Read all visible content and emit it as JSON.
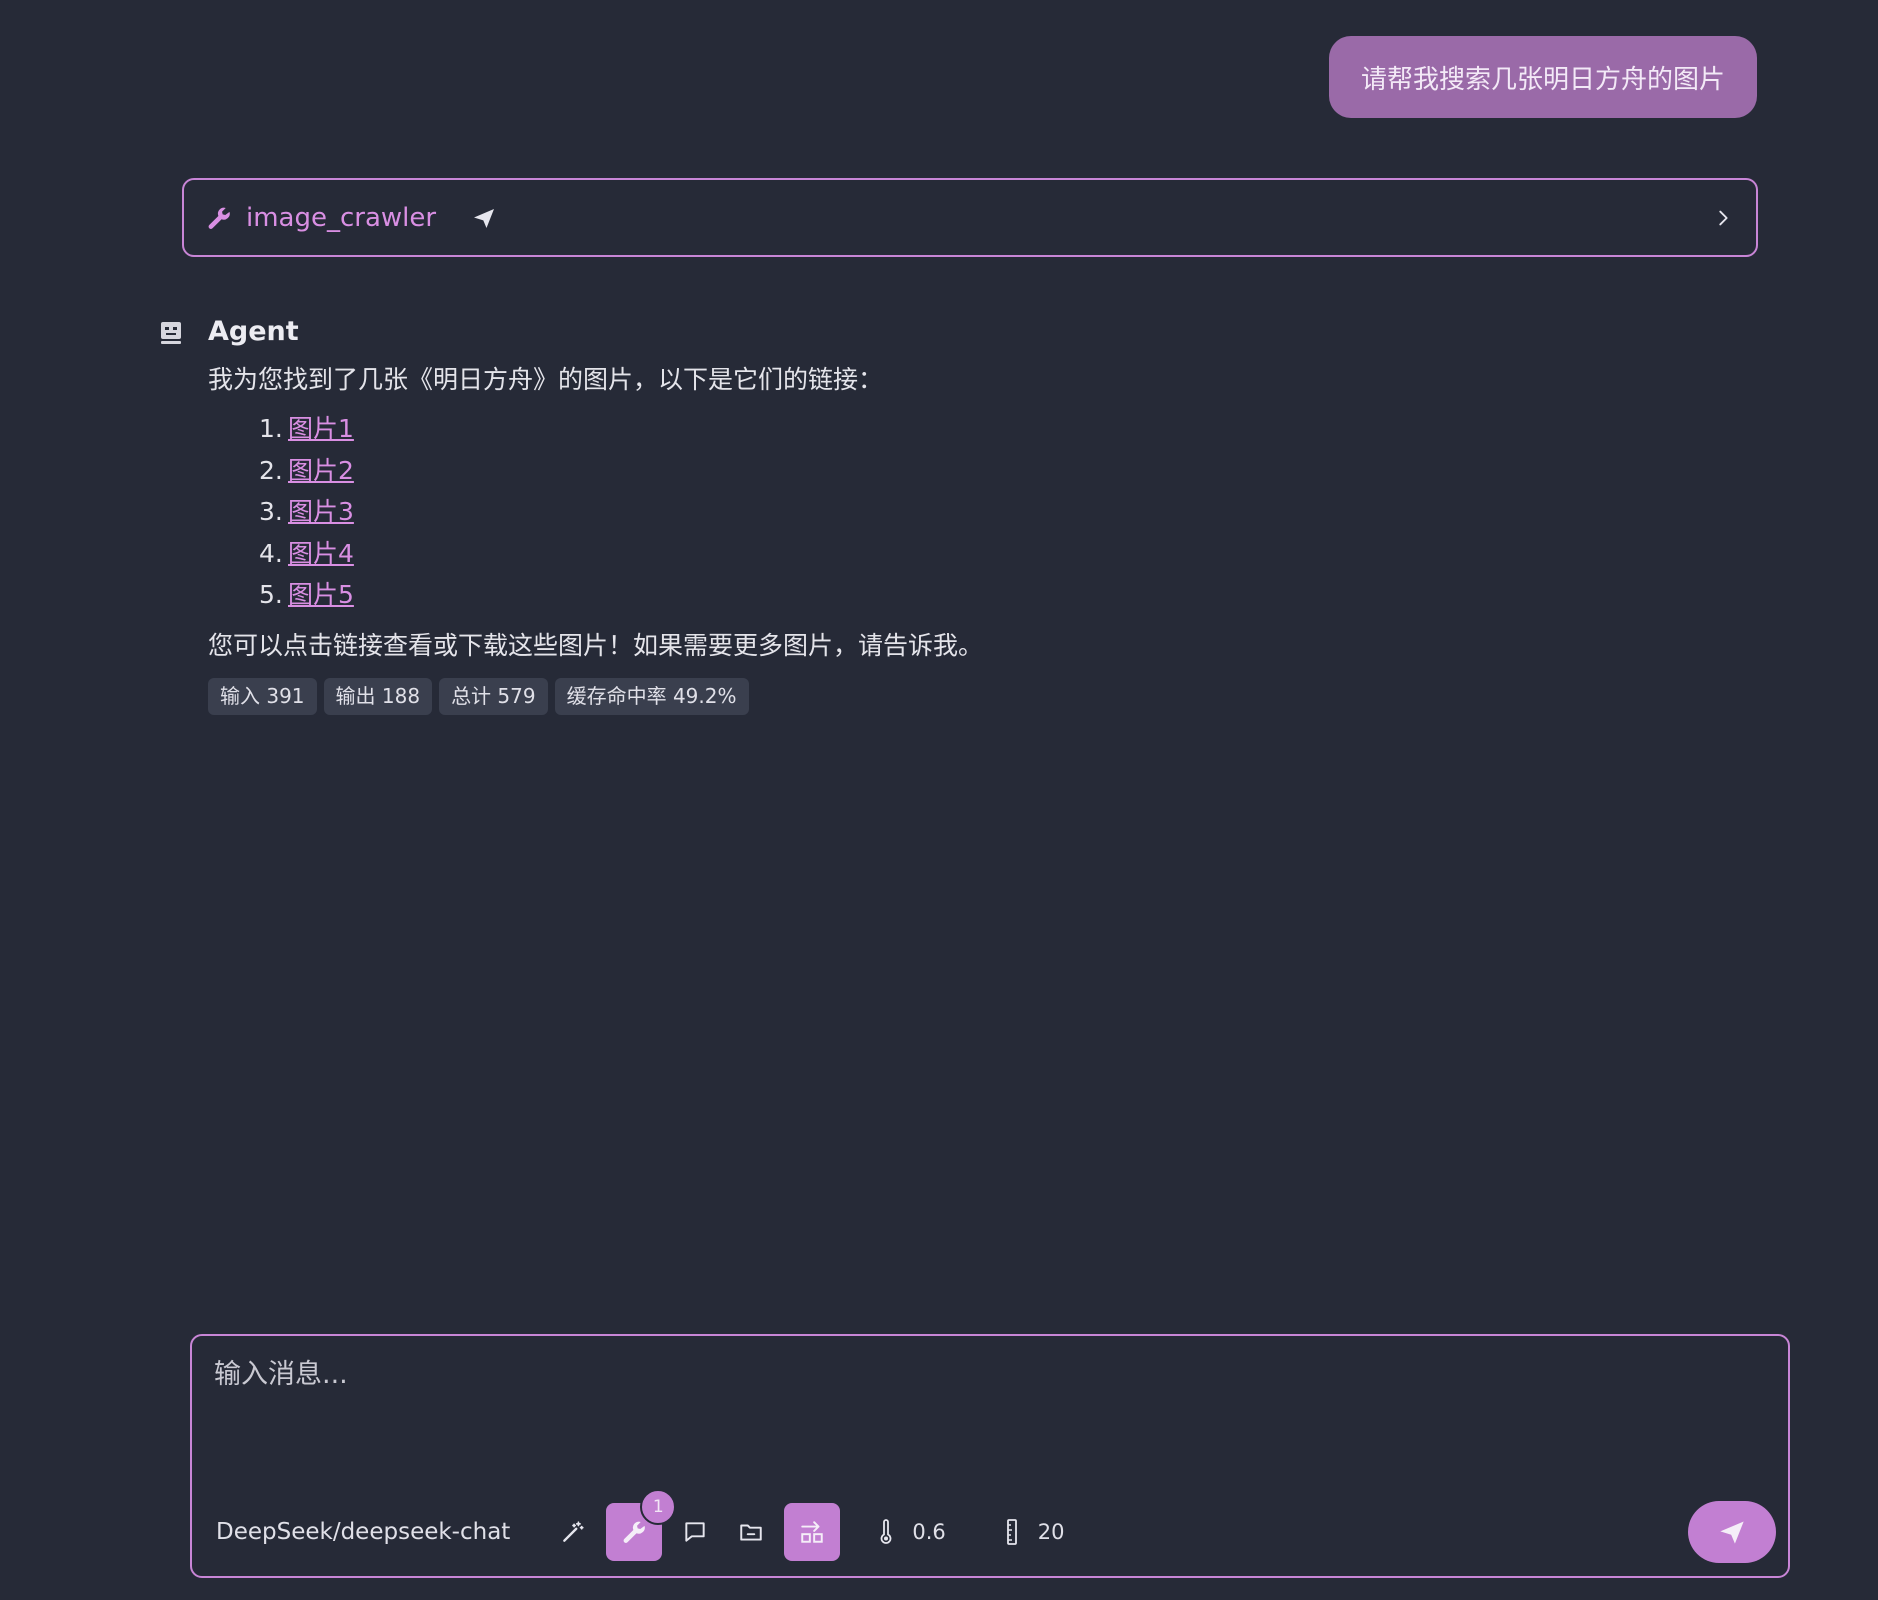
{
  "user_message": "请帮我搜索几张明日方舟的图片",
  "tool_call": {
    "name": "image_crawler",
    "icons": [
      "wrench-icon",
      "paper-plane-icon",
      "chevron-right-icon"
    ]
  },
  "agent": {
    "name": "Agent",
    "intro": "我为您找到了几张《明日方舟》的图片，以下是它们的链接：",
    "links": [
      {
        "num": "1.",
        "label": "图片1"
      },
      {
        "num": "2.",
        "label": "图片2"
      },
      {
        "num": "3.",
        "label": "图片3"
      },
      {
        "num": "4.",
        "label": "图片4"
      },
      {
        "num": "5.",
        "label": "图片5"
      }
    ],
    "outro": "您可以点击链接查看或下载这些图片！如果需要更多图片，请告诉我。",
    "stats": {
      "input": "输入 391",
      "output": "输出 188",
      "total": "总计 579",
      "cache_hit": "缓存命中率 49.2%"
    }
  },
  "composer": {
    "placeholder": "输入消息...",
    "model": "DeepSeek/deepseek-chat",
    "tools_badge": "1",
    "temperature": "0.6",
    "max_context": "20"
  },
  "colors": {
    "background": "#262a37",
    "accent": "#c27fd2",
    "link": "#d98fe3",
    "user_bubble": "#9a6aa8"
  }
}
